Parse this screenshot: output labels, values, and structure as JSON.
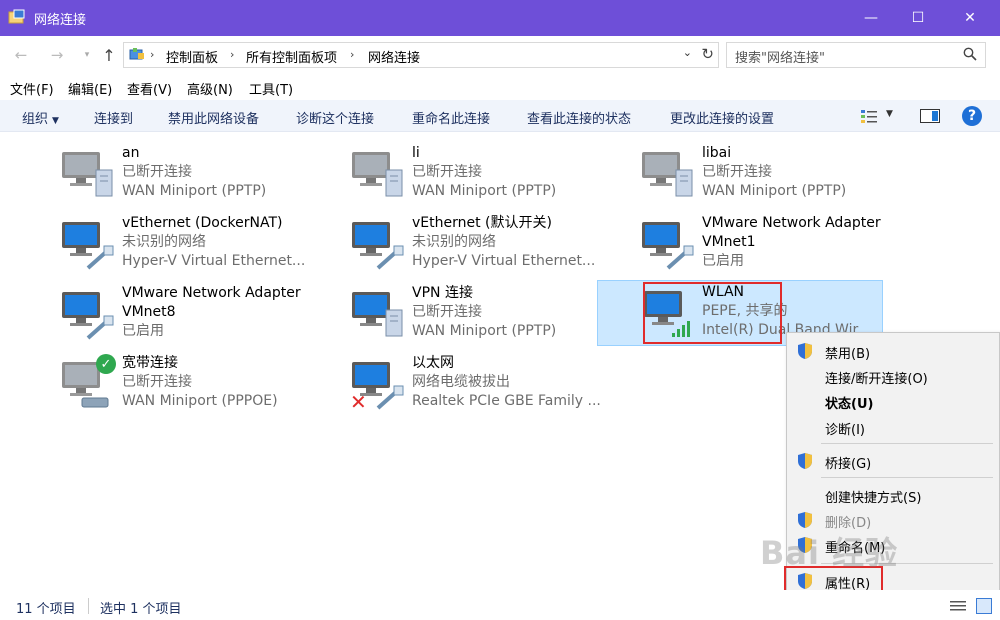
{
  "window": {
    "title": "网络连接",
    "controls": {
      "minimize": "—",
      "maximize": "☐",
      "close": "✕"
    }
  },
  "address": {
    "back": "←",
    "forward": "→",
    "up": "↑",
    "crumbs": [
      "控制面板",
      "所有控制面板项",
      "网络连接"
    ],
    "search_placeholder": "搜索\"网络连接\""
  },
  "menu": [
    "文件(F)",
    "编辑(E)",
    "查看(V)",
    "高级(N)",
    "工具(T)"
  ],
  "commands": [
    "组织",
    "连接到",
    "禁用此网络设备",
    "诊断这个连接",
    "重命名此连接",
    "查看此连接的状态",
    "更改此连接的设置"
  ],
  "connections": [
    {
      "name": "an",
      "status": "已断开连接",
      "device": "WAN Miniport (PPTP)",
      "icon": "vpn-icon",
      "badge": ""
    },
    {
      "name": "li",
      "status": "已断开连接",
      "device": "WAN Miniport (PPTP)",
      "icon": "vpn-icon",
      "badge": ""
    },
    {
      "name": "libai",
      "status": "已断开连接",
      "device": "WAN Miniport (PPTP)",
      "icon": "vpn-icon",
      "badge": ""
    },
    {
      "name": "vEthernet (DockerNAT)",
      "status": "未识别的网络",
      "device": "Hyper-V Virtual Ethernet...",
      "icon": "ethernet-icon",
      "badge": ""
    },
    {
      "name": "vEthernet (默认开关)",
      "status": "未识别的网络",
      "device": "Hyper-V Virtual Ethernet...",
      "icon": "ethernet-icon",
      "badge": ""
    },
    {
      "name": "VMware Network Adapter",
      "status": "VMnet1",
      "device": "已启用",
      "icon": "ethernet-icon",
      "badge": ""
    },
    {
      "name": "VMware Network Adapter",
      "status": "VMnet8",
      "device": "已启用",
      "icon": "ethernet-icon",
      "badge": ""
    },
    {
      "name": "VPN 连接",
      "status": "已断开连接",
      "device": "WAN Miniport (PPTP)",
      "icon": "vpn-icon",
      "badge": ""
    },
    {
      "name": "WLAN",
      "status": "PEPE, 共享的",
      "device": "Intel(R) Dual Band Wirele...",
      "icon": "wifi-icon",
      "badge": ""
    },
    {
      "name": "宽带连接",
      "status": "已断开连接",
      "device": "WAN Miniport (PPPOE)",
      "icon": "broadband-icon",
      "badge": "check"
    },
    {
      "name": "以太网",
      "status": "网络电缆被拔出",
      "device": "Realtek PCIe GBE Family ...",
      "icon": "ethernet-icon",
      "badge": "x"
    }
  ],
  "context_menu": [
    {
      "label": "禁用(B)",
      "shield": true,
      "bold": false
    },
    {
      "label": "连接/断开连接(O)",
      "shield": false,
      "bold": false
    },
    {
      "label": "状态(U)",
      "shield": false,
      "bold": true
    },
    {
      "label": "诊断(I)",
      "shield": false,
      "bold": false
    },
    {
      "label": "桥接(G)",
      "shield": true,
      "bold": false
    },
    {
      "label": "创建快捷方式(S)",
      "shield": false,
      "bold": false
    },
    {
      "label": "删除(D)",
      "shield": true,
      "bold": false
    },
    {
      "label": "重命名(M)",
      "shield": true,
      "bold": false
    },
    {
      "label": "属性(R)",
      "shield": true,
      "bold": false
    }
  ],
  "status": {
    "count": "11 个项目",
    "selected": "选中 1 个项目"
  },
  "watermark": "Bai 经验",
  "colors": {
    "titlebar": "#6e4fd8",
    "selection": "#cce8ff",
    "highlight": "#e02b2b",
    "command_text": "#1e3160"
  }
}
